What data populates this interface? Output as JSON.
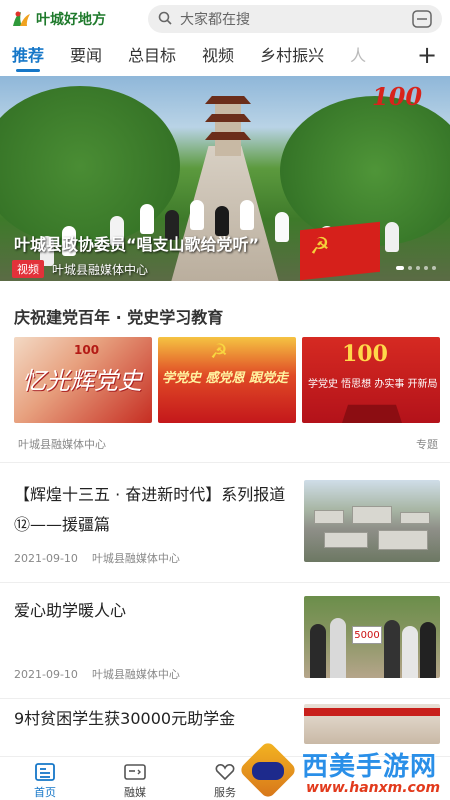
{
  "app": {
    "logo_text": "叶城好地方",
    "search_placeholder": "大家都在搜"
  },
  "tabs": [
    {
      "label": "推荐",
      "active": true
    },
    {
      "label": "要闻"
    },
    {
      "label": "总目标"
    },
    {
      "label": "视频"
    },
    {
      "label": "乡村振兴"
    },
    {
      "label": "人"
    }
  ],
  "hero": {
    "title": "叶城县政协委员“唱支山歌给党听”",
    "tag": "视频",
    "source": "叶城县融媒体中心",
    "badge": "100"
  },
  "special": {
    "title": "庆祝建党百年 · 党史学习教育",
    "source": "叶城县融媒体中心",
    "label": "专题",
    "banners": [
      {
        "main": "忆光辉党史",
        "number": "100"
      },
      {
        "main": "学党史 感党恩 跟党走"
      },
      {
        "main": "学党史 悟思想 办实事 开新局",
        "number": "100"
      }
    ]
  },
  "news": [
    {
      "title": "【辉煌十三五 · 奋进新时代】系列报道⑫——援疆篇",
      "date": "2021-09-10",
      "source": "叶城县融媒体中心"
    },
    {
      "title": "爱心助学暖人心",
      "date": "2021-09-10",
      "source": "叶城县融媒体中心",
      "sign_text": "5000"
    },
    {
      "title": "9村贫困学生获30000元助学金"
    }
  ],
  "bottom_nav": [
    {
      "label": "首页",
      "icon": "home-icon",
      "active": true
    },
    {
      "label": "融媒",
      "icon": "media-icon"
    },
    {
      "label": "服务",
      "icon": "service-icon"
    }
  ],
  "watermark": {
    "title": "西美手游网",
    "url": "www.hanxm.com"
  },
  "colors": {
    "accent": "#1677c8",
    "logo_green": "#1f7a2c",
    "party_red": "#d6201b"
  }
}
